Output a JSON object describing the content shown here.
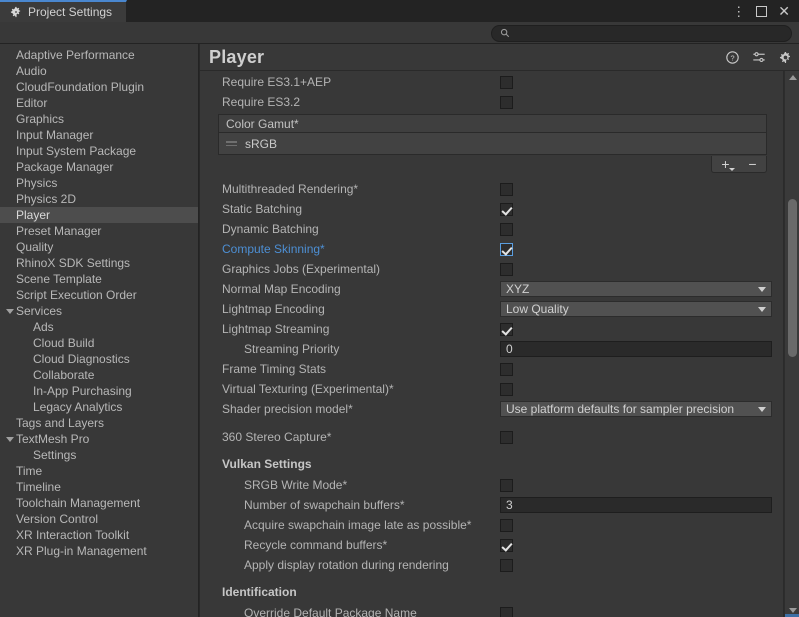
{
  "window": {
    "tab_label": "Project Settings",
    "tab_icon": "gear-icon",
    "controls": {
      "menu": "⋮",
      "maximize": "maximize-icon",
      "close": "✕"
    },
    "accent_color": "#4a87cf"
  },
  "search": {
    "value": "",
    "placeholder": "",
    "icon": "search-icon"
  },
  "sidebar": {
    "items": [
      {
        "label": "Adaptive Performance",
        "indent": 0,
        "selected": false,
        "expander": ""
      },
      {
        "label": "Audio",
        "indent": 0,
        "selected": false,
        "expander": ""
      },
      {
        "label": "CloudFoundation Plugin",
        "indent": 0,
        "selected": false,
        "expander": ""
      },
      {
        "label": "Editor",
        "indent": 0,
        "selected": false,
        "expander": ""
      },
      {
        "label": "Graphics",
        "indent": 0,
        "selected": false,
        "expander": ""
      },
      {
        "label": "Input Manager",
        "indent": 0,
        "selected": false,
        "expander": ""
      },
      {
        "label": "Input System Package",
        "indent": 0,
        "selected": false,
        "expander": ""
      },
      {
        "label": "Package Manager",
        "indent": 0,
        "selected": false,
        "expander": ""
      },
      {
        "label": "Physics",
        "indent": 0,
        "selected": false,
        "expander": ""
      },
      {
        "label": "Physics 2D",
        "indent": 0,
        "selected": false,
        "expander": ""
      },
      {
        "label": "Player",
        "indent": 0,
        "selected": true,
        "expander": ""
      },
      {
        "label": "Preset Manager",
        "indent": 0,
        "selected": false,
        "expander": ""
      },
      {
        "label": "Quality",
        "indent": 0,
        "selected": false,
        "expander": ""
      },
      {
        "label": "RhinoX SDK Settings",
        "indent": 0,
        "selected": false,
        "expander": ""
      },
      {
        "label": "Scene Template",
        "indent": 0,
        "selected": false,
        "expander": ""
      },
      {
        "label": "Script Execution Order",
        "indent": 0,
        "selected": false,
        "expander": ""
      },
      {
        "label": "Services",
        "indent": 0,
        "selected": false,
        "expander": "expanded"
      },
      {
        "label": "Ads",
        "indent": 1,
        "selected": false,
        "expander": ""
      },
      {
        "label": "Cloud Build",
        "indent": 1,
        "selected": false,
        "expander": ""
      },
      {
        "label": "Cloud Diagnostics",
        "indent": 1,
        "selected": false,
        "expander": ""
      },
      {
        "label": "Collaborate",
        "indent": 1,
        "selected": false,
        "expander": ""
      },
      {
        "label": "In-App Purchasing",
        "indent": 1,
        "selected": false,
        "expander": ""
      },
      {
        "label": "Legacy Analytics",
        "indent": 1,
        "selected": false,
        "expander": ""
      },
      {
        "label": "Tags and Layers",
        "indent": 0,
        "selected": false,
        "expander": ""
      },
      {
        "label": "TextMesh Pro",
        "indent": 0,
        "selected": false,
        "expander": "expanded"
      },
      {
        "label": "Settings",
        "indent": 1,
        "selected": false,
        "expander": ""
      },
      {
        "label": "Time",
        "indent": 0,
        "selected": false,
        "expander": ""
      },
      {
        "label": "Timeline",
        "indent": 0,
        "selected": false,
        "expander": ""
      },
      {
        "label": "Toolchain Management",
        "indent": 0,
        "selected": false,
        "expander": ""
      },
      {
        "label": "Version Control",
        "indent": 0,
        "selected": false,
        "expander": ""
      },
      {
        "label": "XR Interaction Toolkit",
        "indent": 0,
        "selected": false,
        "expander": ""
      },
      {
        "label": "XR Plug-in Management",
        "indent": 0,
        "selected": false,
        "expander": ""
      }
    ]
  },
  "main": {
    "title": "Player",
    "header_icons": [
      "help-icon",
      "preset-icon",
      "gear-icon"
    ],
    "clipped_top_row": {
      "label": "Require ES3.1",
      "control": "checkbox"
    },
    "rows_top": [
      {
        "label": "Require ES3.1+AEP",
        "type": "checkbox",
        "checked": false
      },
      {
        "label": "Require ES3.2",
        "type": "checkbox",
        "checked": false
      }
    ],
    "color_gamut_list": {
      "header": "Color Gamut*",
      "items": [
        "sRGB"
      ],
      "add_label": "+",
      "remove_label": "−"
    },
    "rows_mid": [
      {
        "label": "Multithreaded Rendering*",
        "type": "checkbox",
        "checked": false,
        "indent": 0,
        "highlight": false
      },
      {
        "label": "Static Batching",
        "type": "checkbox",
        "checked": true,
        "indent": 0,
        "highlight": false
      },
      {
        "label": "Dynamic Batching",
        "type": "checkbox",
        "checked": false,
        "indent": 0,
        "highlight": false
      },
      {
        "label": "Compute Skinning*",
        "type": "checkbox",
        "checked": true,
        "indent": 0,
        "highlight": true
      },
      {
        "label": "Graphics Jobs (Experimental)",
        "type": "checkbox",
        "checked": false,
        "indent": 0,
        "highlight": false
      },
      {
        "label": "Normal Map Encoding",
        "type": "dropdown",
        "value": "XYZ",
        "indent": 0,
        "highlight": false
      },
      {
        "label": "Lightmap Encoding",
        "type": "dropdown",
        "value": "Low Quality",
        "indent": 0,
        "highlight": false
      },
      {
        "label": "Lightmap Streaming",
        "type": "checkbox",
        "checked": true,
        "indent": 0,
        "highlight": false
      },
      {
        "label": "Streaming Priority",
        "type": "number",
        "value": "0",
        "indent": 1,
        "highlight": false
      },
      {
        "label": "Frame Timing Stats",
        "type": "checkbox",
        "checked": false,
        "indent": 0,
        "highlight": false
      },
      {
        "label": "Virtual Texturing (Experimental)*",
        "type": "checkbox",
        "checked": false,
        "indent": 0,
        "highlight": false
      },
      {
        "label": "Shader precision model*",
        "type": "dropdown",
        "value": "Use platform defaults for sampler precision",
        "indent": 0,
        "highlight": false
      },
      {
        "label": "",
        "type": "spacer",
        "indent": 0,
        "highlight": false
      },
      {
        "label": "360 Stereo Capture*",
        "type": "checkbox",
        "checked": false,
        "indent": 0,
        "highlight": false
      }
    ],
    "vulkan_section": {
      "title": "Vulkan Settings",
      "rows": [
        {
          "label": "SRGB Write Mode*",
          "type": "checkbox",
          "checked": false,
          "indent": 1
        },
        {
          "label": "Number of swapchain buffers*",
          "type": "number",
          "value": "3",
          "indent": 1
        },
        {
          "label": "Acquire swapchain image late as possible*",
          "type": "checkbox",
          "checked": false,
          "indent": 1
        },
        {
          "label": "Recycle command buffers*",
          "type": "checkbox",
          "checked": true,
          "indent": 1
        },
        {
          "label": "Apply display rotation during rendering",
          "type": "checkbox",
          "checked": false,
          "indent": 1
        }
      ]
    },
    "identification_section": {
      "title": "Identification",
      "rows": [
        {
          "label": "Override Default Package Name",
          "type": "checkbox",
          "checked": false,
          "indent": 1
        }
      ]
    }
  }
}
